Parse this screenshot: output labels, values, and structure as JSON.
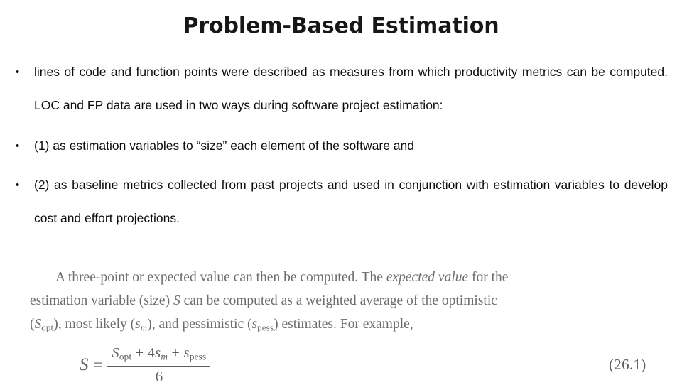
{
  "slide": {
    "title": "Problem-Based  Estimation",
    "bullet_marker": "•"
  },
  "bullets": [
    {
      "text": "lines of code and function points were described as measures from which productivity metrics can be computed. LOC and FP data are used in two ways during software project estimation:"
    },
    {
      "text": "(1) as estimation variables to “size” each element of the software and"
    },
    {
      "text": "(2) as baseline metrics collected from past projects and used in conjunction with estimation variables to develop cost and effort projections."
    }
  ],
  "excerpt": {
    "line1_a": "A three-point or expected value can then be computed. The ",
    "line1_italic": "expected value",
    "line1_b": " for the",
    "line2_a": "estimation variable (size) ",
    "line2_italic": "S",
    "line2_b": " can be computed as a weighted average of the optimistic",
    "line3_a": "(",
    "line3_s1": "S",
    "line3_sub1": "opt",
    "line3_b": "), most likely (",
    "line3_s2": "s",
    "line3_sub2": "m",
    "line3_c": "), and pessimistic (",
    "line3_s3": "s",
    "line3_sub3": "pess",
    "line3_d": ") estimates. For example,"
  },
  "equation": {
    "lhs": "S",
    "equals": "=",
    "numerator_s1": "S",
    "numerator_sub1": "opt",
    "numerator_plus1": " + 4",
    "numerator_s2": "s",
    "numerator_sub2": "m",
    "numerator_plus2": " + ",
    "numerator_s3": "s",
    "numerator_sub3": "pess",
    "denominator": "6",
    "number": "(26.1)"
  },
  "colors": {
    "text": "#0d0d0d",
    "title": "#171717",
    "excerpt": "#6f6c6b",
    "background": "#ffffff"
  }
}
